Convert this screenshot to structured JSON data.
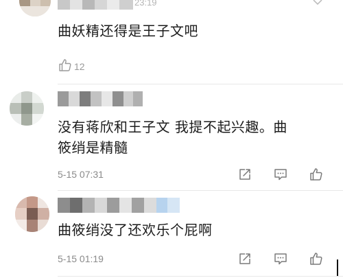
{
  "top_comment": {
    "time_text": "23:19",
    "body": "曲妖精还得是王子文吧",
    "likes": "12"
  },
  "comments": [
    {
      "body_line1": "没有蒋欣和王子文  我提不起兴趣。曲",
      "body_line2": "筱绡是精髓",
      "time": "5-15 07:31"
    },
    {
      "body_line1": "曲筱绡没了还欢乐个屁啊",
      "time": "5-15 01:19"
    }
  ],
  "icons": {
    "like": "thumbs-up-icon",
    "reply": "comment-bubble-icon",
    "share": "share-edit-icon",
    "more": "chevron-down-icon"
  },
  "colors": {
    "icon": "#7a7a7a",
    "divider": "#e8e8e8",
    "time": "#8a8a8a"
  }
}
